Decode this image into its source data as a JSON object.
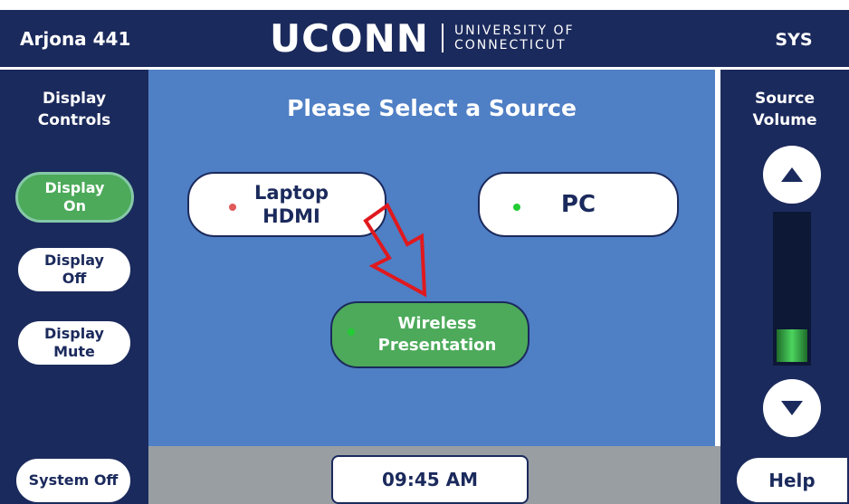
{
  "header": {
    "room": "Arjona 441",
    "logo_word": "UCONN",
    "logo_line1": "UNIVERSITY OF",
    "logo_line2": "CONNECTICUT",
    "sys_label": "SYS"
  },
  "left_panel": {
    "title_line1": "Display",
    "title_line2": "Controls",
    "buttons": [
      {
        "line1": "Display",
        "line2": "On",
        "active": true
      },
      {
        "line1": "Display",
        "line2": "Off",
        "active": false
      },
      {
        "line1": "Display",
        "line2": "Mute",
        "active": false
      }
    ],
    "system_off": "System Off"
  },
  "main": {
    "title": "Please Select a Source",
    "sources": [
      {
        "line1": "Laptop",
        "line2": "HDMI",
        "status_color": "#e05a5a",
        "selected": false
      },
      {
        "line1": "PC",
        "line2": "",
        "status_color": "#22cc33",
        "selected": false
      },
      {
        "line1": "Wireless",
        "line2": "Presentation",
        "status_color": "#22cc33",
        "selected": true
      }
    ],
    "time": "09:45 AM"
  },
  "right_panel": {
    "title_line1": "Source",
    "title_line2": "Volume",
    "volume_up_icon": "triangle-up-icon",
    "volume_down_icon": "triangle-down-icon",
    "volume_level": 0.22,
    "help": "Help"
  },
  "colors": {
    "navy": "#1b2a5c",
    "main_blue": "#4f7fc5",
    "green": "#4caa5a",
    "arrow_red": "#e0191e"
  },
  "annotation": {
    "arrow_icon": "red-arrow-icon"
  }
}
